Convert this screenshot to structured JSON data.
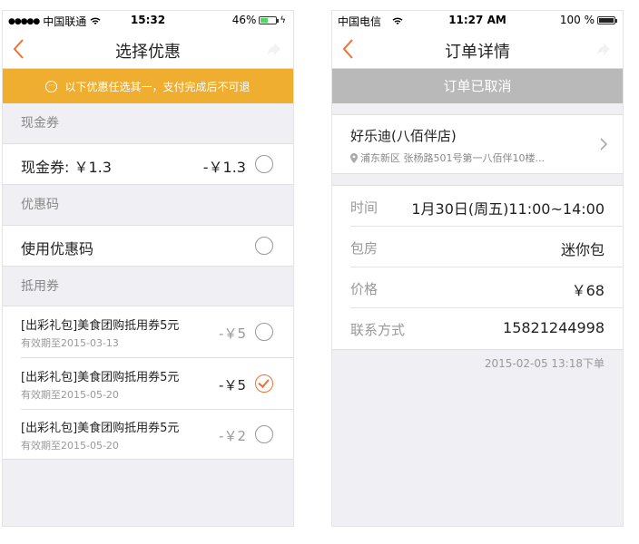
{
  "left_screen": {
    "status": {
      "carrier": "中国联通",
      "signal": "●●●●●",
      "time": "15:32",
      "battery": "46%"
    },
    "nav": {
      "title": "选择优惠"
    },
    "notice": "以下优惠任选其一，支付完成后不可退",
    "sections": {
      "cash": {
        "header": "现金券",
        "label": "现金券: ￥1.3",
        "amount": "-￥1.3"
      },
      "promo": {
        "header": "优惠码",
        "label": "使用优惠码"
      },
      "vouchers": {
        "header": "抵用券",
        "items": [
          {
            "title": "[出彩礼包]美食团购抵用券5元",
            "expiry": "有效期至2015-03-13",
            "amount": "-￥5",
            "selected": false
          },
          {
            "title": "[出彩礼包]美食团购抵用券5元",
            "expiry": "有效期至2015-05-20",
            "amount": "-￥5",
            "selected": true
          },
          {
            "title": "[出彩礼包]美食团购抵用券5元",
            "expiry": "有效期至2015-05-20",
            "amount": "-￥2",
            "selected": false
          }
        ]
      }
    }
  },
  "right_screen": {
    "status": {
      "carrier": "中国电信",
      "time": "11:27 AM",
      "battery": "100 %"
    },
    "nav": {
      "title": "订单详情"
    },
    "banner": "订单已取消",
    "shop": {
      "name": "好乐迪(八佰伴店)",
      "address": "浦东新区 张杨路501号第一八佰伴10楼..."
    },
    "details": [
      {
        "key": "时间",
        "value": "1月30日(周五)11:00~14:00"
      },
      {
        "key": "包房",
        "value": "迷你包"
      },
      {
        "key": "价格",
        "value": "￥68"
      },
      {
        "key": "联系方式",
        "value": "15821244998"
      }
    ],
    "created": "2015-02-05 13:18下单"
  },
  "colors": {
    "accent": "#f07032",
    "notice_bg": "#f0ae30",
    "banner_bg": "#b9b9b9"
  }
}
